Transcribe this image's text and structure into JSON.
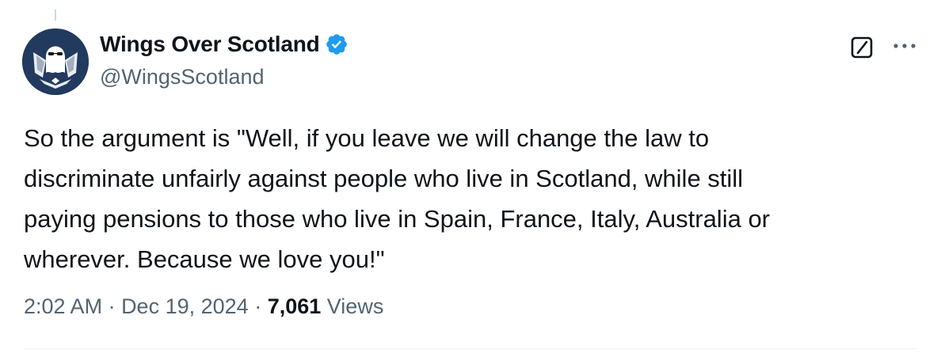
{
  "author": {
    "display_name": "Wings Over Scotland",
    "handle": "@WingsScotland",
    "verified": true
  },
  "tweet": {
    "text": "So the argument is \"Well, if you leave we will change the law to\ndiscriminate unfairly against people who live in Scotland, while still\npaying pensions to those who live in Spain, France, Italy, Australia or\nwherever. Because we love you!\"",
    "time": "2:02 AM",
    "separator": " · ",
    "date": "Dec 19, 2024",
    "views_count": "7,061",
    "views_label": "Views"
  },
  "icons": {
    "verified": "verified-badge-icon",
    "grok": "grok-icon",
    "more": "more-options-icon"
  },
  "colors": {
    "text_primary": "#0f1419",
    "text_secondary": "#536471",
    "verified_blue": "#1d9bf0",
    "avatar_bg": "#223a5e"
  }
}
